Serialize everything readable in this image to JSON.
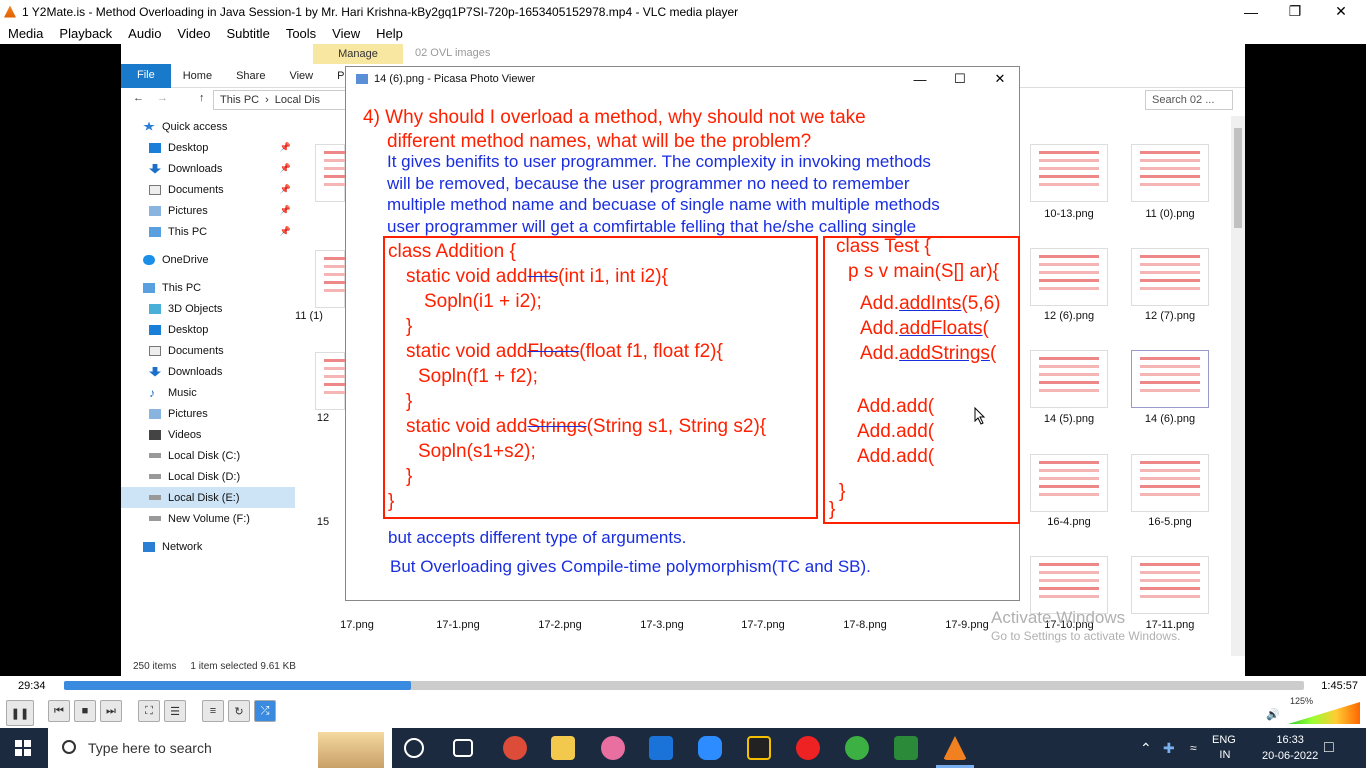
{
  "vlc": {
    "title": "1 Y2Mate.is - Method Overloading in Java  Session-1  by Mr. Hari Krishna-kBy2gq1P7SI-720p-1653405152978.mp4 - VLC media player",
    "menu": [
      "Media",
      "Playback",
      "Audio",
      "Video",
      "Subtitle",
      "Tools",
      "View",
      "Help"
    ],
    "time_current": "29:34",
    "time_total": "1:45:57",
    "progress": 0.28,
    "volume_label": "125%"
  },
  "explorer": {
    "manage": "Manage",
    "folder_title": "02 OVL images",
    "ribbon_tabs": [
      "File",
      "Home",
      "Share",
      "View",
      "Pi"
    ],
    "address": [
      "This PC",
      "Local Dis"
    ],
    "search_placeholder": "Search 02 ...",
    "nav": [
      {
        "label": "Quick access",
        "icon": "star-icon"
      },
      {
        "label": "Desktop",
        "icon": "desktop-icon",
        "pin": true
      },
      {
        "label": "Downloads",
        "icon": "download-icon",
        "pin": true
      },
      {
        "label": "Documents",
        "icon": "documents-icon",
        "pin": true
      },
      {
        "label": "Pictures",
        "icon": "pictures-icon",
        "pin": true
      },
      {
        "label": "This PC",
        "icon": "pc-icon",
        "pin": true
      },
      {
        "label": "OneDrive",
        "icon": "cloud-icon"
      },
      {
        "label": "This PC",
        "icon": "pc-icon"
      },
      {
        "label": "3D Objects",
        "icon": "cube-icon"
      },
      {
        "label": "Desktop",
        "icon": "desktop-icon"
      },
      {
        "label": "Documents",
        "icon": "documents-icon"
      },
      {
        "label": "Downloads",
        "icon": "download-icon"
      },
      {
        "label": "Music",
        "icon": "music-icon"
      },
      {
        "label": "Pictures",
        "icon": "pictures-icon"
      },
      {
        "label": "Videos",
        "icon": "video-icon"
      },
      {
        "label": "Local Disk (C:)",
        "icon": "drive-icon"
      },
      {
        "label": "Local Disk (D:)",
        "icon": "drive-icon"
      },
      {
        "label": "Local Disk (E:)",
        "icon": "drive-icon",
        "selected": true
      },
      {
        "label": "New Volume (F:)",
        "icon": "drive-icon"
      },
      {
        "label": "Network",
        "icon": "network-icon"
      }
    ],
    "thumbs_right": [
      "10-13.png",
      "11 (0).png",
      "12 (6).png",
      "12 (7).png",
      "14 (5).png",
      "14 (6).png",
      "16-4.png",
      "16-5.png"
    ],
    "thumbs_bottom": [
      "17.png",
      "17-1.png",
      "17-2.png",
      "17-3.png",
      "17-7.png",
      "17-8.png",
      "17-9.png",
      "17-10.png",
      "17-11.png"
    ],
    "left_partial": [
      "11 (1)",
      "12",
      "15"
    ],
    "status_items": "250 items",
    "status_selected": "1 item selected  9.61 KB",
    "activate_line1": "Activate Windows",
    "activate_line2": "Go to Settings to activate Windows."
  },
  "picasa": {
    "title": "14 (6).png - Picasa Photo Viewer",
    "question_line1": "4)  Why should I overload a method, why should not we take",
    "question_line2": "different method names, what will be the problem?",
    "answer": [
      "It gives benifits to user programmer. The complexity in invoking methods",
      "will be removed, because the user programmer no need to remember",
      "multiple method name and becuase of single name with multiple methods",
      "user programmer will get a comfirtable felling that he/she calling single"
    ],
    "code_left": {
      "l1": "class Addition {",
      "l2a": "static void add",
      "l2s": "Ints",
      "l2b": "(int i1, int i2){",
      "l3": "Sopln(i1 + i2);",
      "l4": "}",
      "l5a": "static void add",
      "l5s": "Floats",
      "l5b": "(float f1, float f2){",
      "l6": "Sopln(f1 + f2);",
      "l7": "}",
      "l8a": "static void add",
      "l8s": "Strings",
      "l8b": "(String s1, String s2){",
      "l9": "Sopln(s1+s2);",
      "l10": "}",
      "l11": "}"
    },
    "code_right": {
      "l1": "class Test {",
      "l2": "p s v main(S[] ar){",
      "l3a": "Add.",
      "l3u": "addInts",
      "l3b": "(5,6)",
      "l4a": "Add.",
      "l4u": "addFloats",
      "l4b": "(",
      "l5a": "Add.",
      "l5u": "addStrings",
      "l5b": "(",
      "l6": "Add.add(",
      "l7": "Add.add(",
      "l8": "Add.add(",
      "l9": "}",
      "l10": "}"
    },
    "footer1": "but accepts different type of arguments.",
    "footer2": "But Overloading gives Compile-time polymorphism(TC and SB)."
  },
  "taskbar": {
    "search_placeholder": "Type here to search",
    "lang1": "ENG",
    "lang2": "IN",
    "time": "16:33",
    "date": "20-06-2022"
  }
}
